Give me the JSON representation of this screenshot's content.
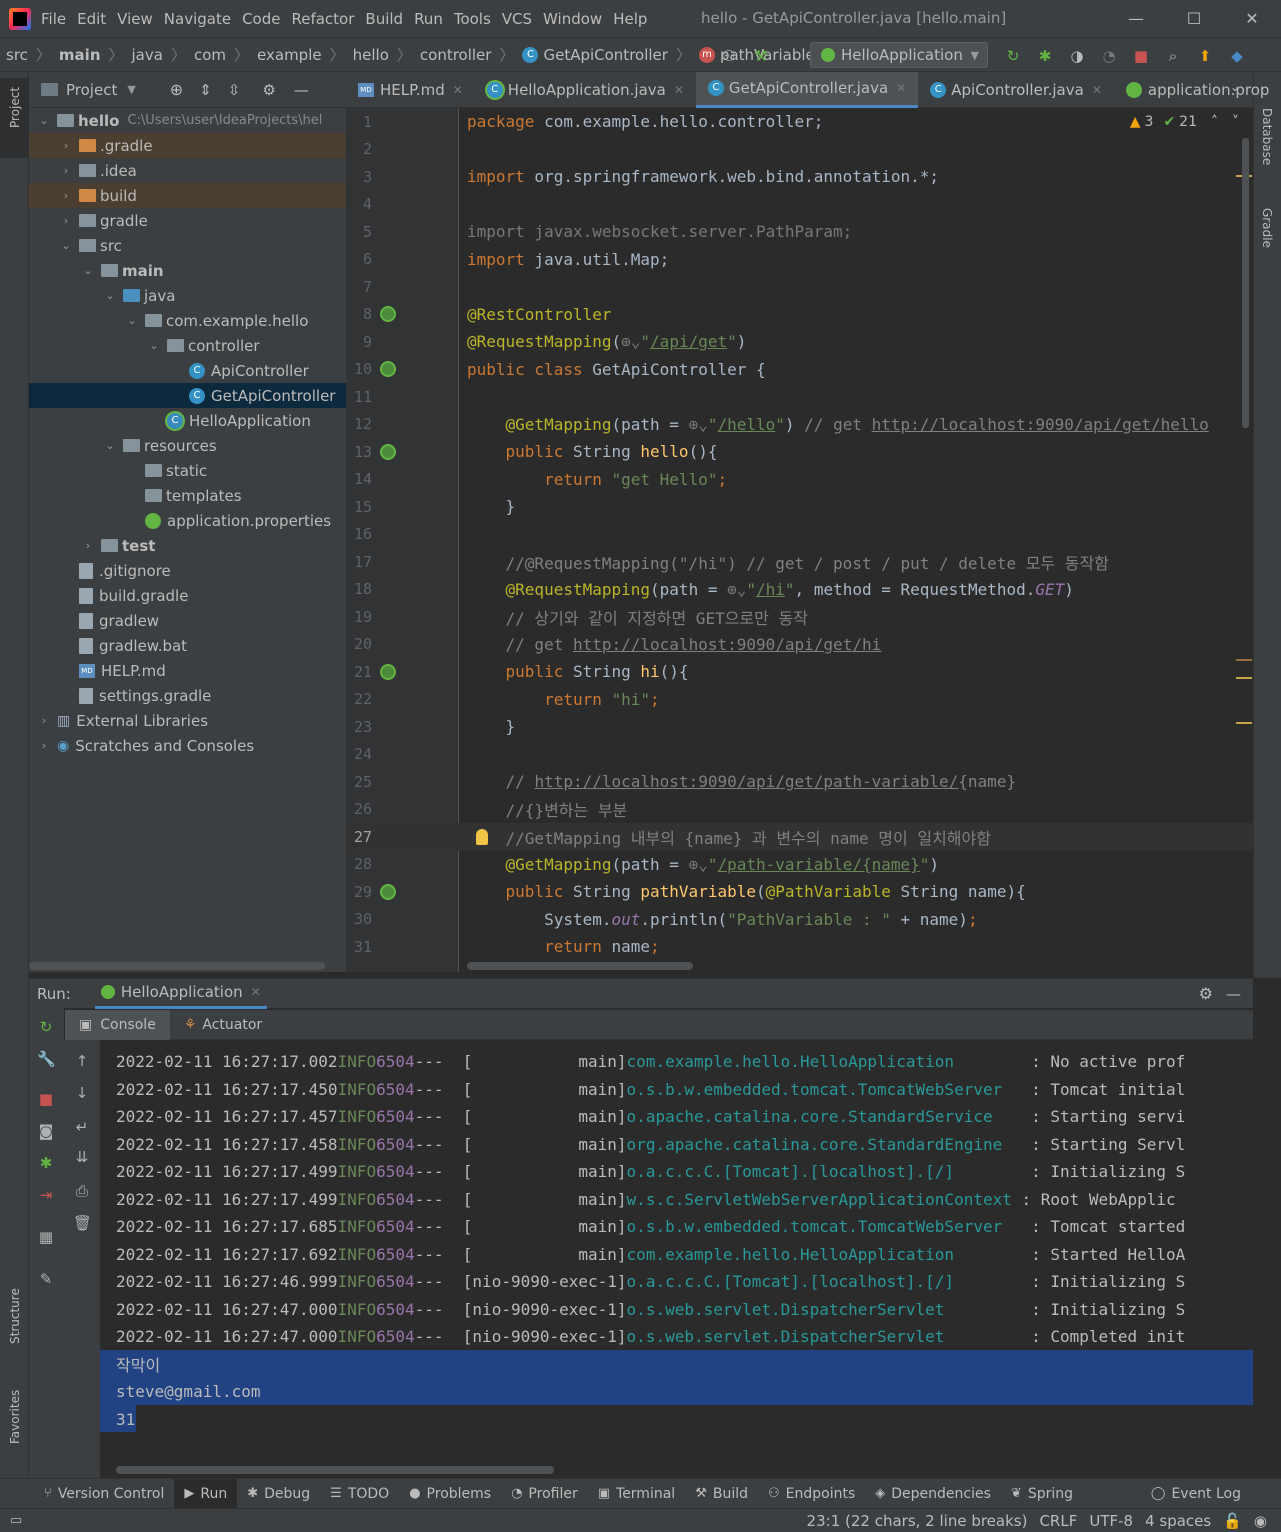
{
  "window": {
    "menu": [
      "File",
      "Edit",
      "View",
      "Navigate",
      "Code",
      "Refactor",
      "Build",
      "Run",
      "Tools",
      "VCS",
      "Window",
      "Help"
    ],
    "title": "hello - GetApiController.java [hello.main]",
    "controls": [
      "—",
      "☐",
      "✕"
    ]
  },
  "navbar": {
    "crumbs": [
      "src",
      "main",
      "java",
      "com",
      "example",
      "hello",
      "controller",
      "GetApiController",
      "pathVariable"
    ],
    "run_config": "HelloApplication"
  },
  "project": {
    "title": "Project",
    "root_name": "hello",
    "root_path": "C:\\Users\\user\\IdeaProjects\\hel",
    "items": [
      {
        "label": ".gradle",
        "depth": 1,
        "arrow": "›",
        "kind": "orange",
        "hl": "excl"
      },
      {
        "label": ".idea",
        "depth": 1,
        "arrow": "›",
        "kind": "folder",
        "hl": ""
      },
      {
        "label": "build",
        "depth": 1,
        "arrow": "›",
        "kind": "orange",
        "hl": "excl"
      },
      {
        "label": "gradle",
        "depth": 1,
        "arrow": "›",
        "kind": "folder",
        "hl": ""
      },
      {
        "label": "src",
        "depth": 1,
        "arrow": "⌄",
        "kind": "folder",
        "hl": ""
      },
      {
        "label": "main",
        "depth": 2,
        "arrow": "⌄",
        "kind": "folder",
        "hl": "",
        "bold": true
      },
      {
        "label": "java",
        "depth": 3,
        "arrow": "⌄",
        "kind": "blue",
        "hl": ""
      },
      {
        "label": "com.example.hello",
        "depth": 4,
        "arrow": "⌄",
        "kind": "folder",
        "hl": ""
      },
      {
        "label": "controller",
        "depth": 5,
        "arrow": "⌄",
        "kind": "folder",
        "hl": ""
      },
      {
        "label": "ApiController",
        "depth": 6,
        "arrow": "",
        "kind": "class",
        "hl": ""
      },
      {
        "label": "GetApiController",
        "depth": 6,
        "arrow": "",
        "kind": "class",
        "hl": "sel"
      },
      {
        "label": "HelloApplication",
        "depth": 5,
        "arrow": "",
        "kind": "spring",
        "hl": ""
      },
      {
        "label": "resources",
        "depth": 3,
        "arrow": "⌄",
        "kind": "folder",
        "hl": ""
      },
      {
        "label": "static",
        "depth": 4,
        "arrow": "",
        "kind": "folder",
        "hl": ""
      },
      {
        "label": "templates",
        "depth": 4,
        "arrow": "",
        "kind": "folder",
        "hl": ""
      },
      {
        "label": "application.properties",
        "depth": 4,
        "arrow": "",
        "kind": "leaf",
        "hl": ""
      },
      {
        "label": "test",
        "depth": 2,
        "arrow": "›",
        "kind": "folder",
        "hl": "",
        "bold": true
      },
      {
        "label": ".gitignore",
        "depth": 1,
        "arrow": "",
        "kind": "file",
        "hl": ""
      },
      {
        "label": "build.gradle",
        "depth": 1,
        "arrow": "",
        "kind": "file",
        "hl": ""
      },
      {
        "label": "gradlew",
        "depth": 1,
        "arrow": "",
        "kind": "file",
        "hl": ""
      },
      {
        "label": "gradlew.bat",
        "depth": 1,
        "arrow": "",
        "kind": "file",
        "hl": ""
      },
      {
        "label": "HELP.md",
        "depth": 1,
        "arrow": "",
        "kind": "md",
        "hl": ""
      },
      {
        "label": "settings.gradle",
        "depth": 1,
        "arrow": "",
        "kind": "file",
        "hl": ""
      },
      {
        "label": "External Libraries",
        "depth": 0,
        "arrow": "›",
        "kind": "lib",
        "hl": ""
      },
      {
        "label": "Scratches and Consoles",
        "depth": 0,
        "arrow": "›",
        "kind": "scratch",
        "hl": ""
      }
    ]
  },
  "side_tools": {
    "left_top": "Project",
    "left_mid": "Structure",
    "left_bottom": "Favorites",
    "right_top": "Database",
    "right_mid": "Gradle"
  },
  "tabs": [
    {
      "label": "HELP.md",
      "icon": "md",
      "active": false,
      "close": "✕"
    },
    {
      "label": "HelloApplication.java",
      "icon": "spring",
      "active": false,
      "close": "✕"
    },
    {
      "label": "GetApiController.java",
      "icon": "class",
      "active": true,
      "close": "✕"
    },
    {
      "label": "ApiController.java",
      "icon": "class",
      "active": false,
      "close": "✕"
    },
    {
      "label": "application.prop",
      "icon": "leaf",
      "active": false,
      "close": ""
    }
  ],
  "inspections": {
    "warnings": "3",
    "ok": "21"
  },
  "code_lines": [
    {
      "n": "1",
      "h": "<span class='kw'>package</span> com.example.hello.controller;"
    },
    {
      "n": "2",
      "h": ""
    },
    {
      "n": "3",
      "h": "<span class='kw'>import</span> org.springframework.web.bind.annotation.*;"
    },
    {
      "n": "4",
      "h": ""
    },
    {
      "n": "5",
      "h": "<span class='gray'>import javax.websocket.server.PathParam;</span>"
    },
    {
      "n": "6",
      "h": "<span class='kw'>import</span> java.util.Map;"
    },
    {
      "n": "7",
      "h": ""
    },
    {
      "n": "8",
      "h": "<span class='ann'>@RestController</span>",
      "g": "bean"
    },
    {
      "n": "9",
      "h": "<span class='ann'>@RequestMapping</span>(<span class='gray'>⊕⌄</span><span class='str'>\"<span class='lnk'>/api/get</span>\"</span>)"
    },
    {
      "n": "10",
      "h": "<span class='kw'>public class</span> GetApiController {",
      "g": "bean"
    },
    {
      "n": "11",
      "h": ""
    },
    {
      "n": "12",
      "h": "    <span class='ann'>@GetMapping</span>(path = <span class='gray'>⊕⌄</span><span class='str'>\"<span class='lnk'>/hello</span>\"</span>) <span class='cm'>// get <span class='lnk'>http://localhost:9090/api/get/hello</span></span>"
    },
    {
      "n": "13",
      "h": "    <span class='kw'>public</span> String <span class='fn'>hello</span>(){",
      "g": "bean"
    },
    {
      "n": "14",
      "h": "        <span class='kw'>return</span> <span class='str'>\"get Hello\"</span><span class='kw'>;</span>"
    },
    {
      "n": "15",
      "h": "    }"
    },
    {
      "n": "16",
      "h": ""
    },
    {
      "n": "17",
      "h": "    <span class='cm'>//@RequestMapping(\"/hi\") // get / post / put / delete 모두 동작함</span>"
    },
    {
      "n": "18",
      "h": "    <span class='ann'>@RequestMapping</span>(path = <span class='gray'>⊕⌄</span><span class='str'>\"<span class='lnk'>/hi</span>\"</span>, method = RequestMethod.<span class='it'>GET</span>)"
    },
    {
      "n": "19",
      "h": "    <span class='cm'>// 상기와 같이 지정하면 GET으로만 동작</span>"
    },
    {
      "n": "20",
      "h": "    <span class='cm'>// get <span class='lnk'>http://localhost:9090/api/get/hi</span></span>"
    },
    {
      "n": "21",
      "h": "    <span class='kw'>public</span> String <span class='fn'>hi</span>(){",
      "g": "bean"
    },
    {
      "n": "22",
      "h": "        <span class='kw'>return</span> <span class='str'>\"hi\"</span><span class='kw'>;</span>"
    },
    {
      "n": "23",
      "h": "    }"
    },
    {
      "n": "24",
      "h": ""
    },
    {
      "n": "25",
      "h": "    <span class='cm'>// <span class='lnk'>http://localhost:9090/api/get/path-variable/</span>{name}</span>"
    },
    {
      "n": "26",
      "h": "    <span class='cm'>//{}변하는 부분</span>"
    },
    {
      "n": "27",
      "h": "    <span class='cm'>//GetMapping 내부의 {name} 과 변수의 name 명이 일치해야함</span>",
      "cur": true,
      "bulb": true
    },
    {
      "n": "28",
      "h": "    <span class='ann'>@GetMapping</span>(path = <span class='gray'>⊕⌄</span><span class='str'>\"<span class='lnk'>/path-variable/{name}</span>\"</span>)"
    },
    {
      "n": "29",
      "h": "    <span class='kw'>public</span> String <span class='fn'>pathVariable</span>(<span class='ann'>@PathVariable</span> String name){",
      "g": "bean"
    },
    {
      "n": "30",
      "h": "        System.<span class='it'>out</span>.println(<span class='str'>\"PathVariable : \"</span> + name)<span class='kw'>;</span>"
    },
    {
      "n": "31",
      "h": "        <span class='kw'>return</span> name<span class='kw'>;</span>"
    }
  ],
  "run": {
    "label": "Run:",
    "tab": "HelloApplication",
    "console_tab": "Console",
    "actuator_tab": "Actuator"
  },
  "console_lines": [
    {
      "ts": "2022-02-11 16:27:17.002",
      "lvl": "INFO",
      "pid": "6504",
      "thr": "---  [           main]",
      "logger": "com.example.hello.HelloApplication      ",
      "msg": "  : No active prof"
    },
    {
      "ts": "2022-02-11 16:27:17.450",
      "lvl": "INFO",
      "pid": "6504",
      "thr": "---  [           main]",
      "logger": "o.s.b.w.embedded.tomcat.TomcatWebServer ",
      "msg": "  : Tomcat initial"
    },
    {
      "ts": "2022-02-11 16:27:17.457",
      "lvl": "INFO",
      "pid": "6504",
      "thr": "---  [           main]",
      "logger": "o.apache.catalina.core.StandardService  ",
      "msg": "  : Starting servi"
    },
    {
      "ts": "2022-02-11 16:27:17.458",
      "lvl": "INFO",
      "pid": "6504",
      "thr": "---  [           main]",
      "logger": "org.apache.catalina.core.StandardEngine ",
      "msg": "  : Starting Servl"
    },
    {
      "ts": "2022-02-11 16:27:17.499",
      "lvl": "INFO",
      "pid": "6504",
      "thr": "---  [           main]",
      "logger": "o.a.c.c.C.[Tomcat].[localhost].[/]      ",
      "msg": "  : Initializing S"
    },
    {
      "ts": "2022-02-11 16:27:17.499",
      "lvl": "INFO",
      "pid": "6504",
      "thr": "---  [           main]",
      "logger": "w.s.c.ServletWebServerApplicationContext",
      "msg": " : Root WebApplic"
    },
    {
      "ts": "2022-02-11 16:27:17.685",
      "lvl": "INFO",
      "pid": "6504",
      "thr": "---  [           main]",
      "logger": "o.s.b.w.embedded.tomcat.TomcatWebServer ",
      "msg": "  : Tomcat started"
    },
    {
      "ts": "2022-02-11 16:27:17.692",
      "lvl": "INFO",
      "pid": "6504",
      "thr": "---  [           main]",
      "logger": "com.example.hello.HelloApplication      ",
      "msg": "  : Started HelloA"
    },
    {
      "ts": "2022-02-11 16:27:46.999",
      "lvl": "INFO",
      "pid": "6504",
      "thr": "---  [nio-9090-exec-1]",
      "logger": "o.a.c.c.C.[Tomcat].[localhost].[/]      ",
      "msg": "  : Initializing S"
    },
    {
      "ts": "2022-02-11 16:27:47.000",
      "lvl": "INFO",
      "pid": "6504",
      "thr": "---  [nio-9090-exec-1]",
      "logger": "o.s.web.servlet.DispatcherServlet       ",
      "msg": "  : Initializing S"
    },
    {
      "ts": "2022-02-11 16:27:47.000",
      "lvl": "INFO",
      "pid": "6504",
      "thr": "---  [nio-9090-exec-1]",
      "logger": "o.s.web.servlet.DispatcherServlet       ",
      "msg": "  : Completed init"
    }
  ],
  "console_output": [
    "작막이",
    "steve@gmail.com",
    "31"
  ],
  "bottom_tools": [
    {
      "label": "Version Control",
      "icon": "⑂"
    },
    {
      "label": "Run",
      "icon": "▶",
      "active": true
    },
    {
      "label": "Debug",
      "icon": "✱"
    },
    {
      "label": "TODO",
      "icon": "☰"
    },
    {
      "label": "Problems",
      "icon": "●"
    },
    {
      "label": "Profiler",
      "icon": "◔"
    },
    {
      "label": "Terminal",
      "icon": "▣"
    },
    {
      "label": "Build",
      "icon": "⚒"
    },
    {
      "label": "Endpoints",
      "icon": "⚇"
    },
    {
      "label": "Dependencies",
      "icon": "◈"
    },
    {
      "label": "Spring",
      "icon": "❦"
    }
  ],
  "event_log": "Event Log",
  "status": {
    "position": "23:1 (22 chars, 2 line breaks)",
    "line_sep": "CRLF",
    "encoding": "UTF-8",
    "indent": "4 spaces"
  }
}
